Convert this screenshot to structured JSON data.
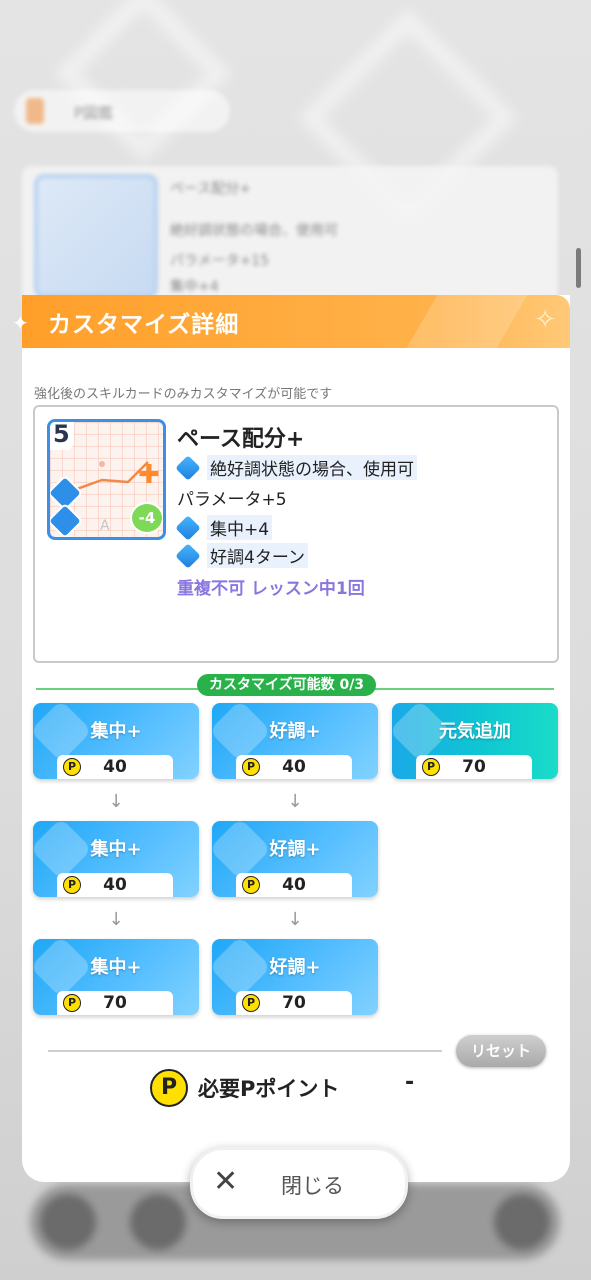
{
  "background": {
    "search_label": "P図鑑",
    "card_lines": [
      "ペース配分+",
      "絶好調状態の場合、使用可",
      "パラメータ+15",
      "集中+4"
    ]
  },
  "modal": {
    "title": "カスタマイズ詳細",
    "note": "強化後のスキルカードのみカスタマイズが可能です",
    "card": {
      "cost": "5",
      "name": "ペース配分+",
      "lines": [
        {
          "icon": "zekkouchou-icon",
          "text": "絶好調状態の場合、使用可"
        },
        {
          "icon": "",
          "text": "パラメータ+5"
        },
        {
          "icon": "concentration-icon",
          "text": "集中+4"
        },
        {
          "icon": "good-condition-icon",
          "text": "好調4ターン"
        }
      ],
      "note": "重複不可 レッスン中1回",
      "heart_value": "-4",
      "letter": "A"
    },
    "customize_count": "カスタマイズ可能数 0/3",
    "options": {
      "col1": [
        {
          "label": "集中+",
          "cost": "40"
        },
        {
          "label": "集中+",
          "cost": "40"
        },
        {
          "label": "集中+",
          "cost": "70"
        }
      ],
      "col2": [
        {
          "label": "好調+",
          "cost": "40"
        },
        {
          "label": "好調+",
          "cost": "40"
        },
        {
          "label": "好調+",
          "cost": "70"
        }
      ],
      "col3": [
        {
          "label": "元気追加",
          "cost": "70"
        }
      ],
      "arrow": "↓",
      "point_symbol": "P"
    },
    "reset_label": "リセット",
    "required_label": "必要Pポイント",
    "required_value": "-",
    "close_label": "閉じる"
  },
  "colors": {
    "header_orange": "#ff9f2a",
    "tile_blue": "#1ea7f6",
    "tile_teal": "#0fc7d2",
    "count_green": "#29b24a",
    "note_purple": "#8a76e0"
  }
}
